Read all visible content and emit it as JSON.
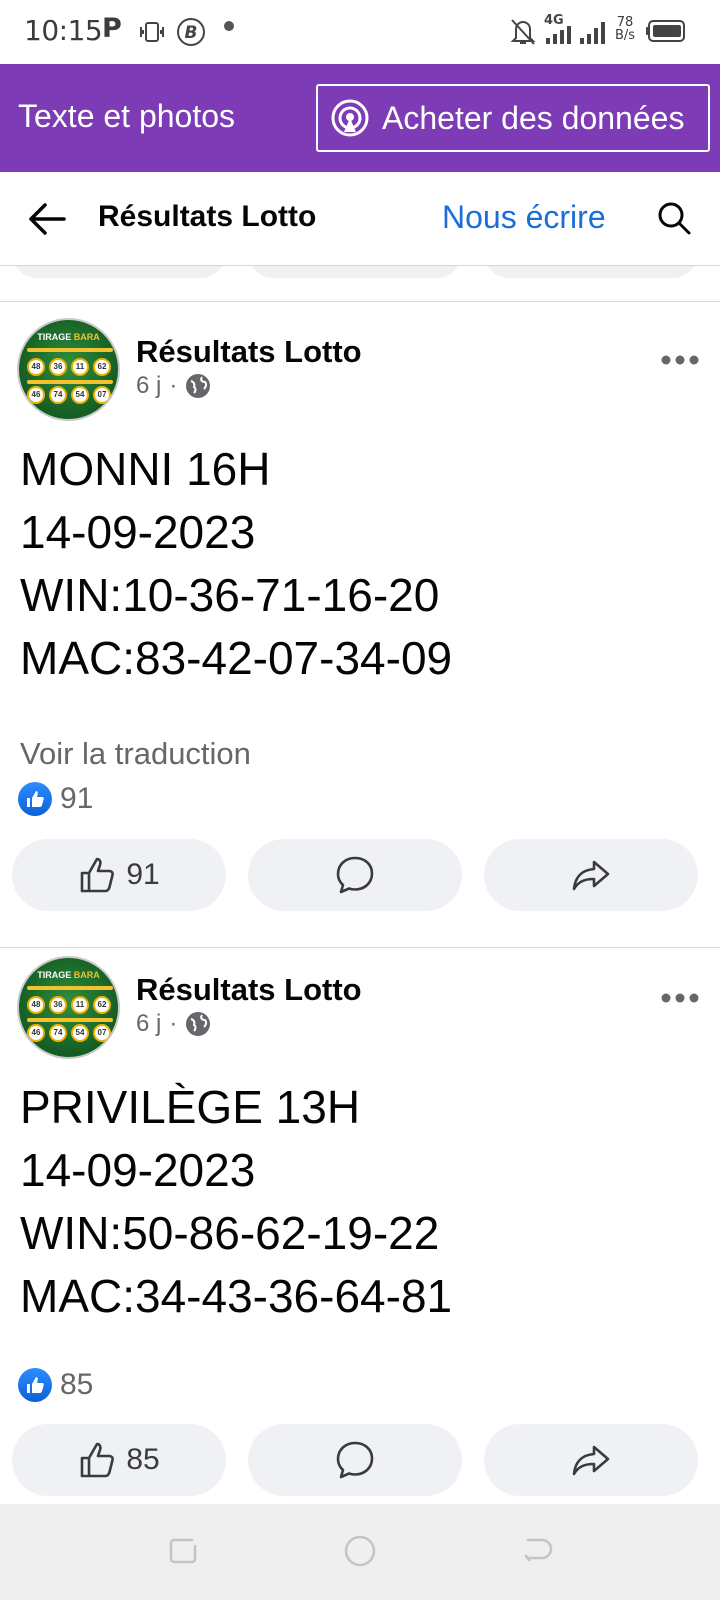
{
  "status_bar": {
    "time": "10:15",
    "carrier_icon": "P",
    "network": "4G",
    "speed_value": "78",
    "speed_unit": "B/s",
    "icons": [
      "parking-icon",
      "vibrate-icon",
      "bitcoin-icon",
      "notification-dot",
      "mute-icon",
      "signal-icon",
      "signal-icon-2",
      "battery-icon"
    ]
  },
  "banner": {
    "mode_label": "Texte et photos",
    "buy_label": "Acheter des données",
    "color": "#7d3cb6"
  },
  "header": {
    "title": "Résultats Lotto",
    "write_link": "Nous écrire"
  },
  "avatar": {
    "title_prefix": "TIRAGE",
    "title_suffix": "BARA",
    "row1": [
      "48",
      "36",
      "11",
      "62"
    ],
    "row2": [
      "46",
      "74",
      "54",
      "07"
    ]
  },
  "posts": [
    {
      "author": "Résultats Lotto",
      "time": "6 j",
      "lines": [
        "MONNI 16H",
        "14-09-2023",
        "WIN:10-36-71-16-20",
        "MAC:83-42-07-34-09"
      ],
      "translate": "Voir la traduction",
      "reactions": "91",
      "like_count": "91"
    },
    {
      "author": "Résultats Lotto",
      "time": "6 j",
      "lines": [
        "PRIVILÈGE 13H",
        "14-09-2023",
        "WIN:50-86-62-19-22",
        "MAC:34-43-36-64-81"
      ],
      "reactions": "85",
      "like_count": "85"
    }
  ],
  "colors": {
    "link_blue": "#1a6ed8",
    "like_blue": "#0a62d6",
    "pill_gray": "#eff1f4",
    "meta_gray": "#65676b"
  }
}
